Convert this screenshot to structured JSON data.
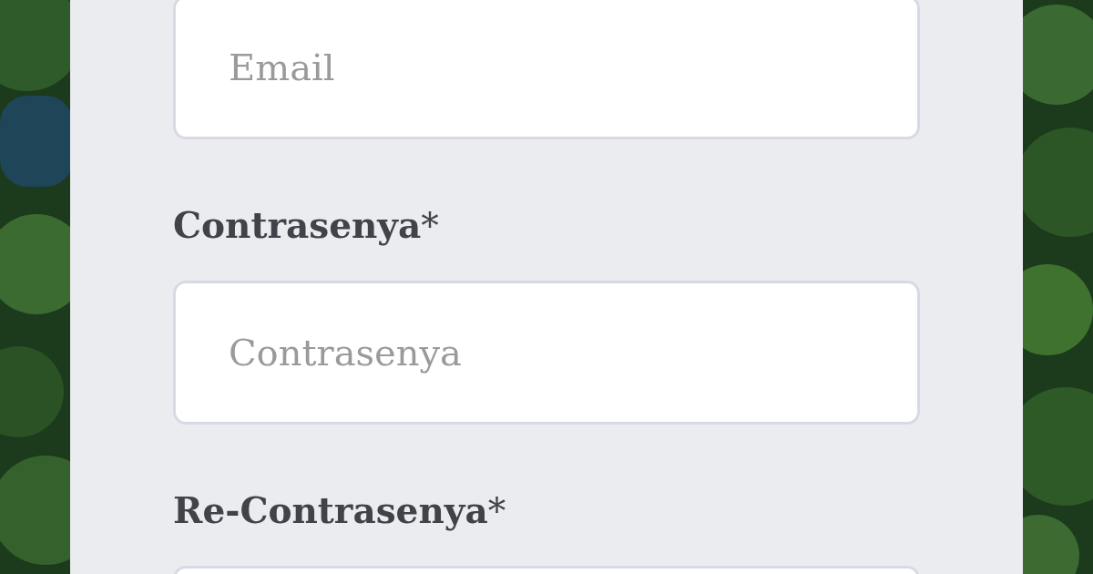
{
  "form": {
    "fields": [
      {
        "placeholder": "Email"
      },
      {
        "label": "Contrasenya",
        "required_mark": "*",
        "placeholder": "Contrasenya"
      },
      {
        "label": "Re-Contrasenya",
        "required_mark": "*"
      }
    ]
  }
}
